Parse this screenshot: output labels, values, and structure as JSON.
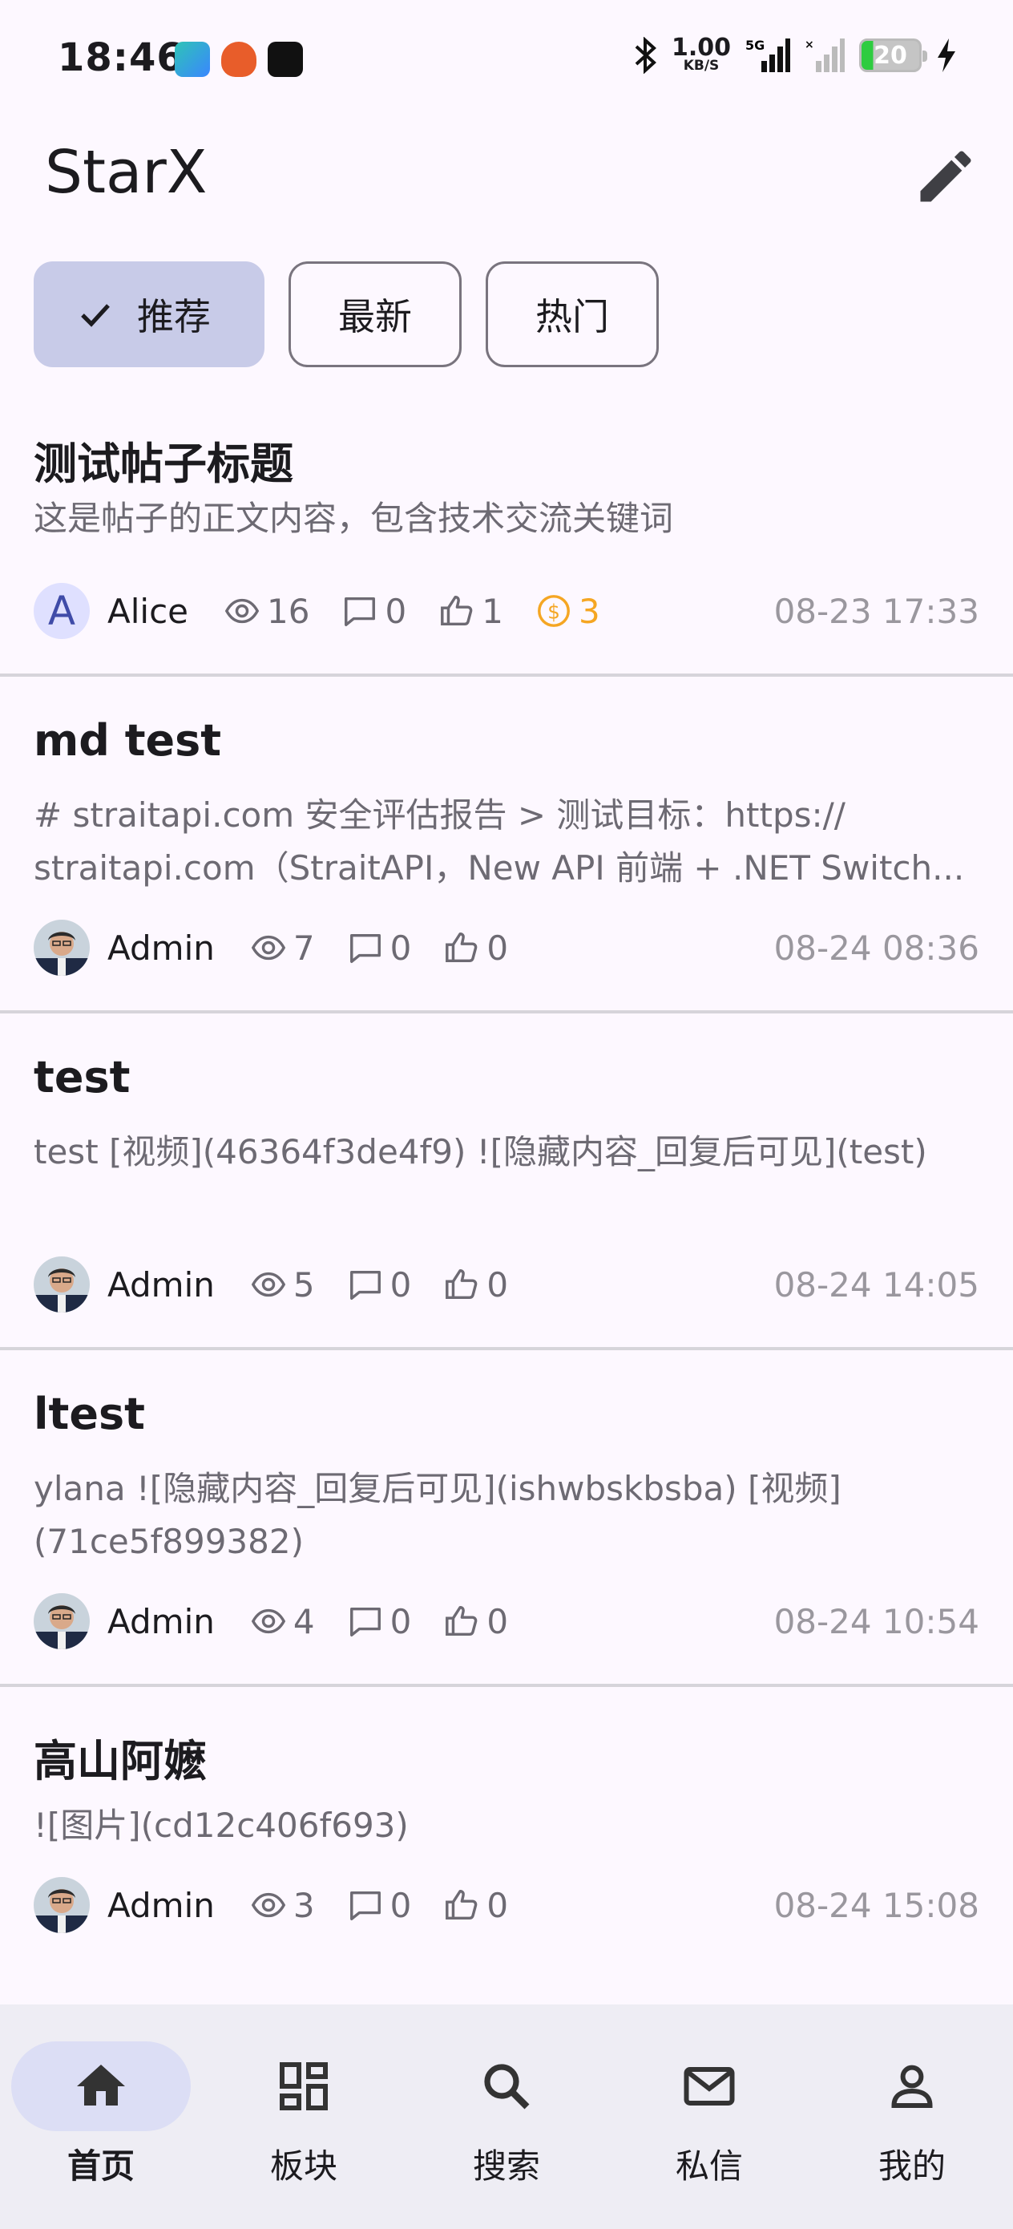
{
  "status_bar": {
    "time": "18:46",
    "net_speed": "1.00",
    "net_unit": "KB/S",
    "network": "5G",
    "battery": "20"
  },
  "app_bar": {
    "title": "StarX",
    "edit_icon": "edit-pencil-icon"
  },
  "tabs": [
    {
      "label": "推荐",
      "selected": true
    },
    {
      "label": "最新",
      "selected": false
    },
    {
      "label": "热门",
      "selected": false
    }
  ],
  "posts": [
    {
      "title": "测试帖子标题",
      "body": "这是帖子的正文内容，包含技术交流关键词",
      "author": "Alice",
      "avatar_letter": "A",
      "views": "16",
      "comments": "0",
      "likes": "1",
      "coins": "3",
      "time": "08-23 17:33"
    },
    {
      "title": "md test",
      "body": "# straitapi.com 安全评估报告 > 测试目标：https:// straitapi.com（StraitAPI，New API 前端 + .NET Switch...",
      "author": "Admin",
      "views": "7",
      "comments": "0",
      "likes": "0",
      "time": "08-24 08:36"
    },
    {
      "title": "test",
      "body": "test [视频](46364f3de4f9) ![隐藏内容_回复后可见](test)",
      "author": "Admin",
      "views": "5",
      "comments": "0",
      "likes": "0",
      "time": "08-24 14:05"
    },
    {
      "title": "ltest",
      "body": "ylana ![隐藏内容_回复后可见](ishwbskbsba) [视频](71ce5f899382)",
      "author": "Admin",
      "views": "4",
      "comments": "0",
      "likes": "0",
      "time": "08-24 10:54"
    },
    {
      "title": "高山阿嬷",
      "body": "![图片](cd12c406f693)",
      "author": "Admin",
      "views": "3",
      "comments": "0",
      "likes": "0",
      "time": "08-24 15:08"
    }
  ],
  "bottom_nav": [
    {
      "label": "首页",
      "icon": "home-icon",
      "active": true
    },
    {
      "label": "板块",
      "icon": "grid-icon",
      "active": false
    },
    {
      "label": "搜索",
      "icon": "search-icon",
      "active": false
    },
    {
      "label": "私信",
      "icon": "mail-icon",
      "active": false
    },
    {
      "label": "我的",
      "icon": "person-icon",
      "active": false
    }
  ],
  "colors": {
    "background": "#fdf8ff",
    "selected_tab": "#c8cbe8",
    "nav_background": "#eeedf4",
    "coin": "#f5a623"
  }
}
